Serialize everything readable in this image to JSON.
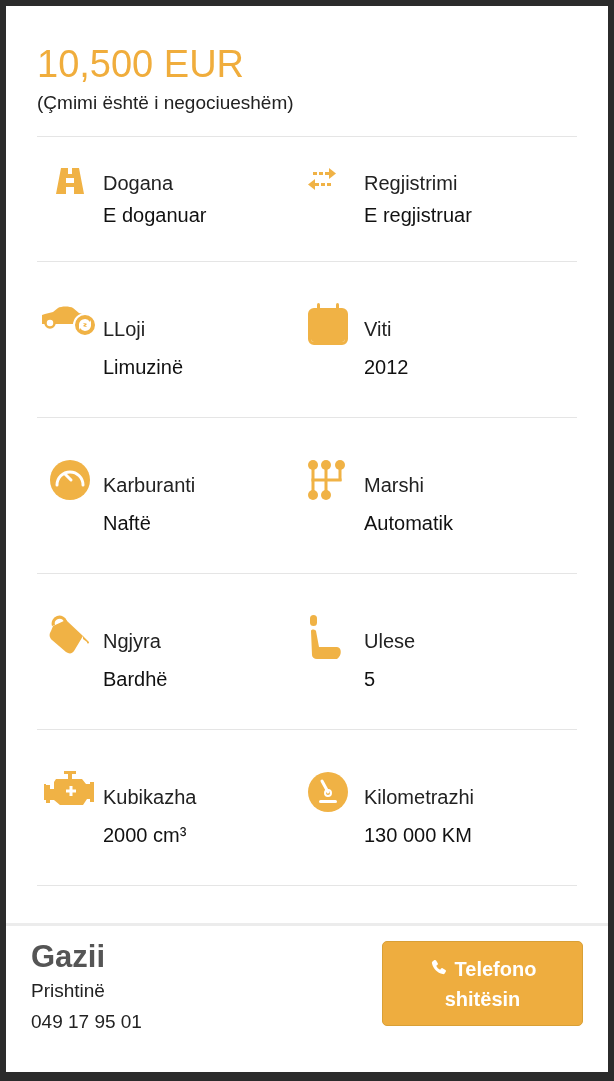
{
  "price": "10,500 EUR",
  "price_note": "(Çmimi është i negociueshëm)",
  "specs": [
    [
      {
        "kind": "road",
        "label": "Dogana",
        "value": "E doganuar"
      },
      {
        "kind": "arrows",
        "label": "Regjistrimi",
        "value": "E regjistruar"
      }
    ],
    [
      {
        "kind": "car",
        "label": "LLoji",
        "value": "Limuzinë"
      },
      {
        "kind": "calendar",
        "label": "Viti",
        "value": "2012"
      }
    ],
    [
      {
        "kind": "gauge",
        "label": "Karburanti",
        "value": "Naftë"
      },
      {
        "kind": "gearbox",
        "label": "Marshi",
        "value": "Automatik"
      }
    ],
    [
      {
        "kind": "paint",
        "label": "Ngjyra",
        "value": "Bardhë"
      },
      {
        "kind": "seat",
        "label": "Ulese",
        "value": "5"
      }
    ],
    [
      {
        "kind": "engine",
        "label": "Kubikazha",
        "value": "2000 cm³"
      },
      {
        "kind": "odometer",
        "label": "Kilometrazhi",
        "value": "130 000 KM"
      }
    ]
  ],
  "seller": {
    "name": "Gazii",
    "city": "Prishtinë",
    "phone": "049 17 95 01"
  },
  "call_button": "Telefono shitësin"
}
